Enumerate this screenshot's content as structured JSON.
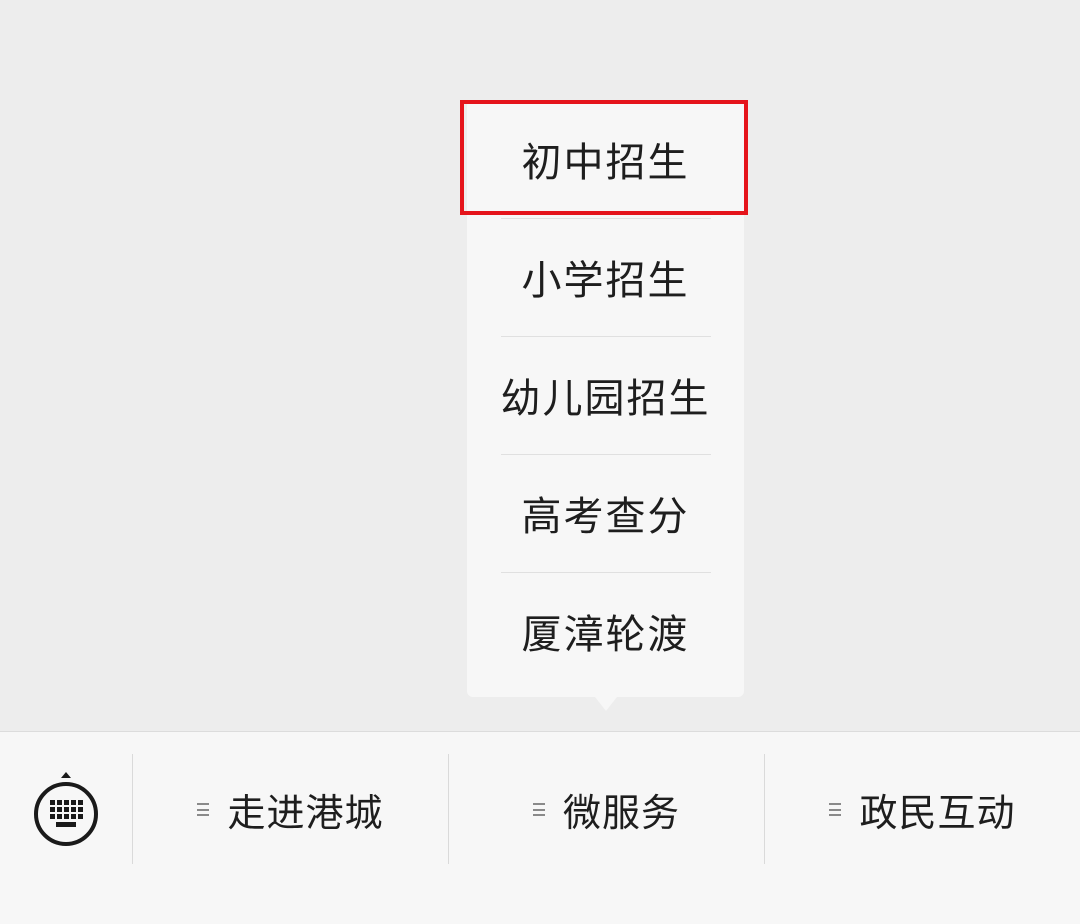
{
  "submenu": {
    "items": [
      {
        "label": "初中招生"
      },
      {
        "label": "小学招生"
      },
      {
        "label": "幼儿园招生"
      },
      {
        "label": "高考查分"
      },
      {
        "label": "厦漳轮渡"
      }
    ],
    "highlight_color": "#e5141b"
  },
  "bottom_menu": {
    "keyboard_icon": "keyboard-icon",
    "items": [
      {
        "label": "走进港城",
        "icon": "menu-lines-icon"
      },
      {
        "label": "微服务",
        "icon": "menu-lines-icon"
      },
      {
        "label": "政民互动",
        "icon": "menu-lines-icon"
      }
    ]
  }
}
